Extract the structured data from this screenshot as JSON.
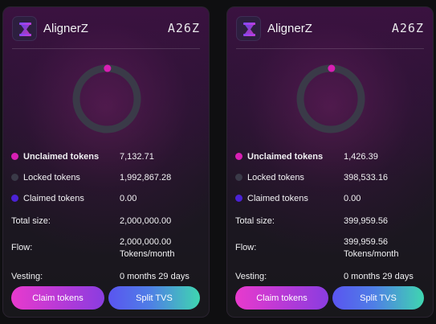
{
  "colors": {
    "unclaimed": "#d81fb4",
    "locked": "#3a3a48",
    "claimed": "#4b22d6"
  },
  "cards": [
    {
      "app_name": "AlignerZ",
      "ticker": "A26Z",
      "logo_icon": "hourglass-icon",
      "rows": [
        {
          "label": "Unclaimed tokens",
          "value": "7,132.71"
        },
        {
          "label": "Locked tokens",
          "value": "1,992,867.28"
        },
        {
          "label": "Claimed tokens",
          "value": "0.00"
        },
        {
          "label": "Total size:",
          "value": "2,000,000.00"
        },
        {
          "label": "Flow:",
          "value": "2,000,000.00",
          "value_unit": "Tokens/month"
        },
        {
          "label": "Vesting:",
          "value": "0 months 29 days"
        }
      ],
      "donut": {
        "unclaimed": 7132.71,
        "locked": 1992867.28,
        "claimed": 0
      },
      "buttons": {
        "claim": "Claim tokens",
        "split": "Split TVS"
      }
    },
    {
      "app_name": "AlignerZ",
      "ticker": "A26Z",
      "logo_icon": "hourglass-icon",
      "rows": [
        {
          "label": "Unclaimed tokens",
          "value": "1,426.39"
        },
        {
          "label": "Locked tokens",
          "value": "398,533.16"
        },
        {
          "label": "Claimed tokens",
          "value": "0.00"
        },
        {
          "label": "Total size:",
          "value": "399,959.56"
        },
        {
          "label": "Flow:",
          "value": "399,959.56",
          "value_unit": "Tokens/month"
        },
        {
          "label": "Vesting:",
          "value": "0 months 29 days"
        }
      ],
      "donut": {
        "unclaimed": 1426.39,
        "locked": 398533.16,
        "claimed": 0
      },
      "buttons": {
        "claim": "Claim tokens",
        "split": "Split TVS"
      }
    }
  ]
}
